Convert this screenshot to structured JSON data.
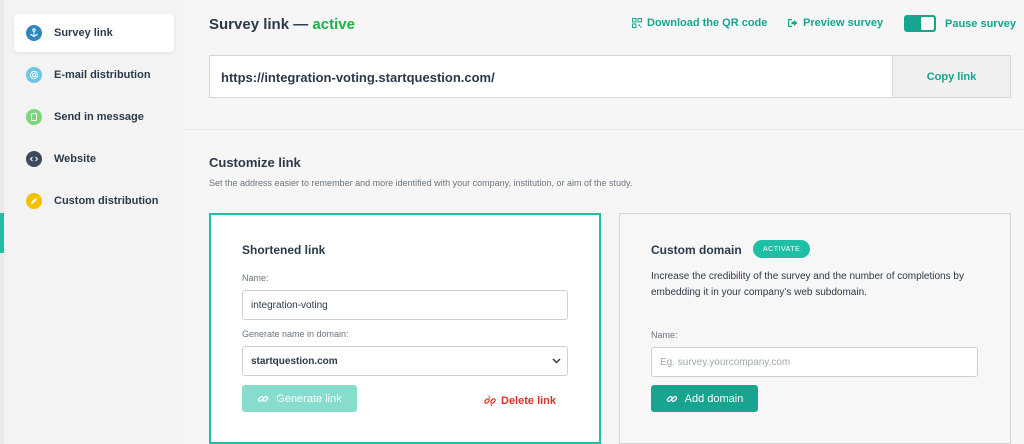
{
  "sidebar": {
    "items": [
      {
        "label": "Survey link",
        "icon": "anchor-icon",
        "color": "#2e86c1"
      },
      {
        "label": "E-mail distribution",
        "icon": "at-icon",
        "color": "#6cc5e8"
      },
      {
        "label": "Send in message",
        "icon": "message-icon",
        "color": "#7ed67a"
      },
      {
        "label": "Website",
        "icon": "code-icon",
        "color": "#3b4a5c"
      },
      {
        "label": "Custom distribution",
        "icon": "pencil-icon",
        "color": "#f2c200"
      }
    ]
  },
  "header": {
    "title": "Survey link —",
    "status": "active",
    "download_qr": "Download the QR code",
    "preview": "Preview survey",
    "pause": "Pause survey"
  },
  "link": {
    "url": "https://integration-voting.startquestion.com/",
    "copy_label": "Copy link"
  },
  "customize": {
    "title": "Customize link",
    "description": "Set the address easier to remember and more identified with your company, institution, or aim of the study."
  },
  "shortened": {
    "title": "Shortened link",
    "name_label": "Name:",
    "name_value": "integration-voting",
    "domain_label": "Generate name in domain:",
    "domain_value": "startquestion.com",
    "generate_label": "Generate link",
    "delete_label": "Delete link"
  },
  "custom_domain": {
    "title": "Custom domain",
    "badge": "ACTIVATE",
    "description": "Increase the credibility of the survey and the number of completions by embedding it in your company's web subdomain.",
    "name_label": "Name:",
    "placeholder": "Eg. survey.yourcompany.com",
    "add_label": "Add domain"
  },
  "colors": {
    "accent": "#17a58f",
    "active_status": "#19b24a",
    "delete": "#d9312b"
  }
}
